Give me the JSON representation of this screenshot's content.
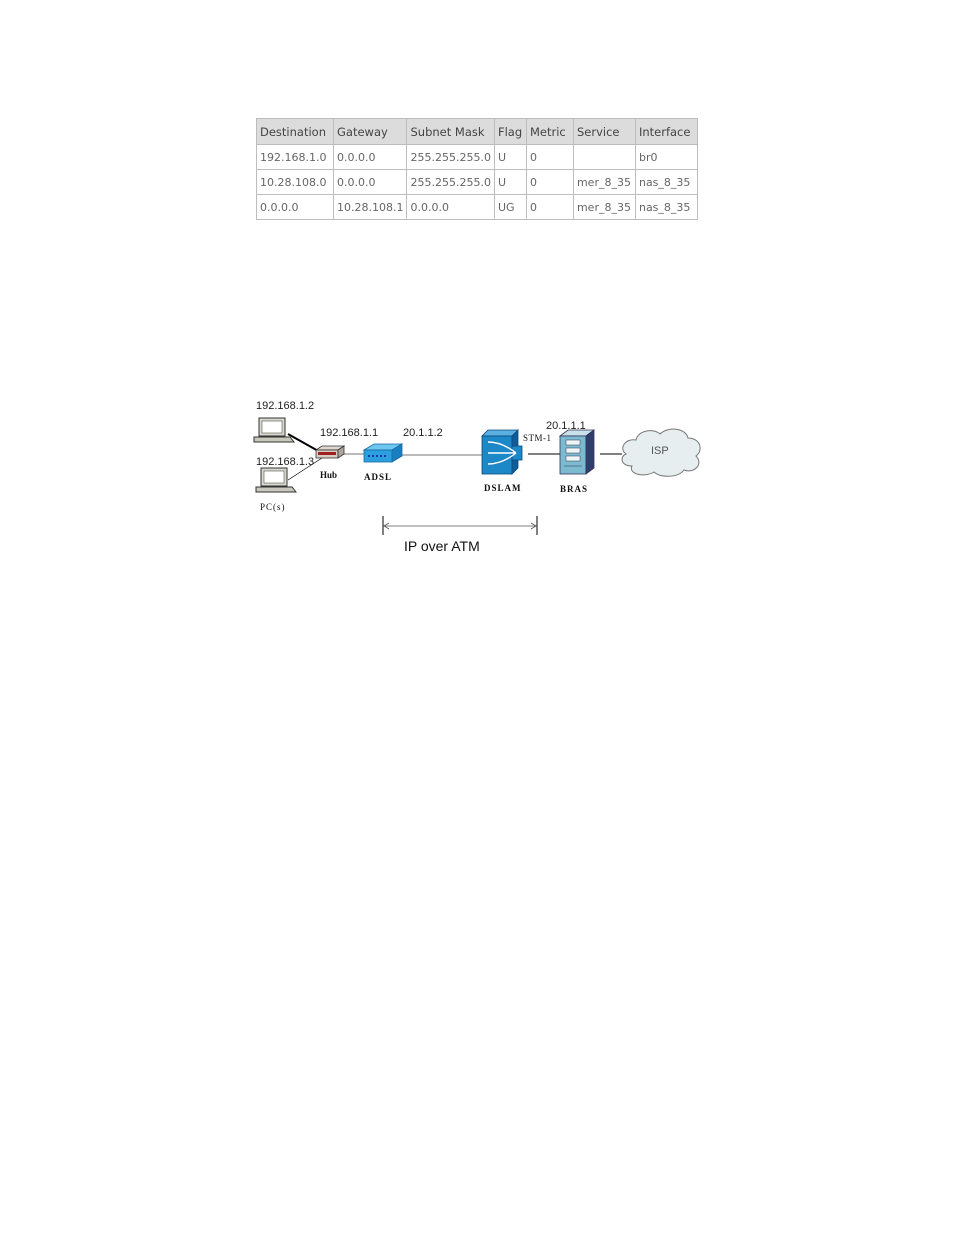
{
  "routing_table": {
    "headers": [
      "Destination",
      "Gateway",
      "Subnet Mask",
      "Flag",
      "Metric",
      "Service",
      "Interface"
    ],
    "rows": [
      [
        "192.168.1.0",
        "0.0.0.0",
        "255.255.255.0",
        "U",
        "0",
        "",
        "br0"
      ],
      [
        "10.28.108.0",
        "0.0.0.0",
        "255.255.255.0",
        "U",
        "0",
        "mer_8_35",
        "nas_8_35"
      ],
      [
        "0.0.0.0",
        "10.28.108.1",
        "0.0.0.0",
        "UG",
        "0",
        "mer_8_35",
        "nas_8_35"
      ]
    ]
  },
  "diagram": {
    "pc1_ip": "192.168.1.2",
    "pc2_ip": "192.168.1.3",
    "pcs_label": "PC(s)",
    "hub_label": "Hub",
    "lan_ip": "192.168.1.1",
    "adsl_label": "ADSL",
    "wan_ip": "20.1.1.2",
    "dslam_label": "DSLAM",
    "stm_label": "STM-1",
    "bras_ip": "20.1.1.1",
    "bras_label": "BRAS",
    "isp_label": "ISP",
    "span_label": "IP over ATM"
  }
}
